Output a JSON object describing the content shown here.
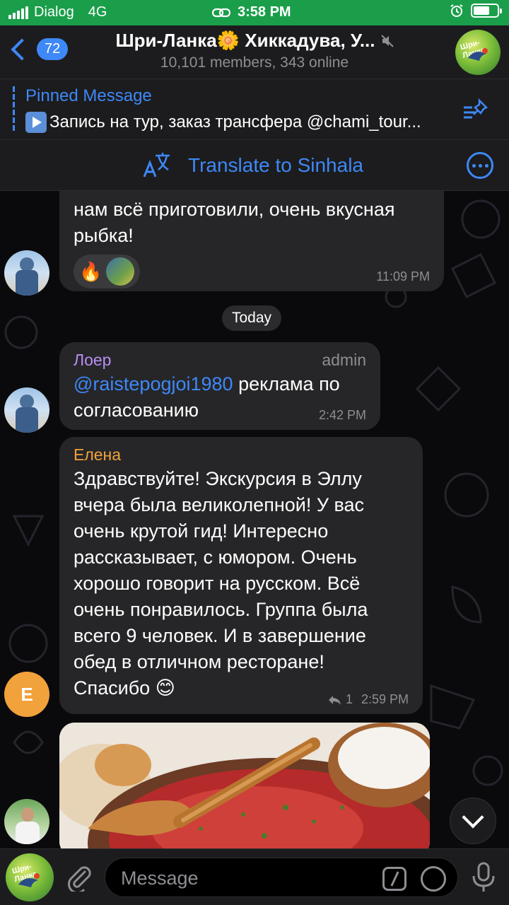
{
  "status_bar": {
    "carrier": "Dialog",
    "network": "4G",
    "time": "3:58 PM",
    "battery_level": 0.7
  },
  "header": {
    "back_count": "72",
    "title": "Шри-Ланка🌼 Хиккадува, У...",
    "subtitle": "10,101 members, 343 online",
    "avatar_label": "Шри-Ланка"
  },
  "pinned": {
    "title": "Pinned Message",
    "text": "Запись на тур, заказ трансфера @chami_tour..."
  },
  "translate": {
    "label": "Translate to Sinhala"
  },
  "messages": [
    {
      "text": "нам всё приготовили, очень вкусная рыбка!",
      "time": "11:09 PM",
      "reactions": [
        "🔥"
      ]
    },
    {
      "date": "Today"
    },
    {
      "sender": "Лоер",
      "sender_color": "#b98df2",
      "role": "admin",
      "mention": "@raistepogjoi1980",
      "text": " реклама по согласованию",
      "time": "2:42 PM"
    },
    {
      "sender": "Елена",
      "sender_color": "#f1a23b",
      "avatar_letter": "Е",
      "text": "Здравствуйте! Экскурсия в Эллу вчера была великолепной! У вас очень крутой гид! Интересно рассказывает,  с юмором. Очень хорошо говорит на русском. Всё очень понравилось. Группа была всего 9 человек.   И в завершение обед в отличном ресторане! Спасибо 😊",
      "reply_count": "1",
      "time": "2:59 PM"
    }
  ],
  "input": {
    "placeholder": "Message",
    "avatar_label": "Шри-Ланка"
  },
  "colors": {
    "accent": "#3e88f7",
    "status_bar": "#1a9e4a",
    "bubble": "#262628"
  }
}
